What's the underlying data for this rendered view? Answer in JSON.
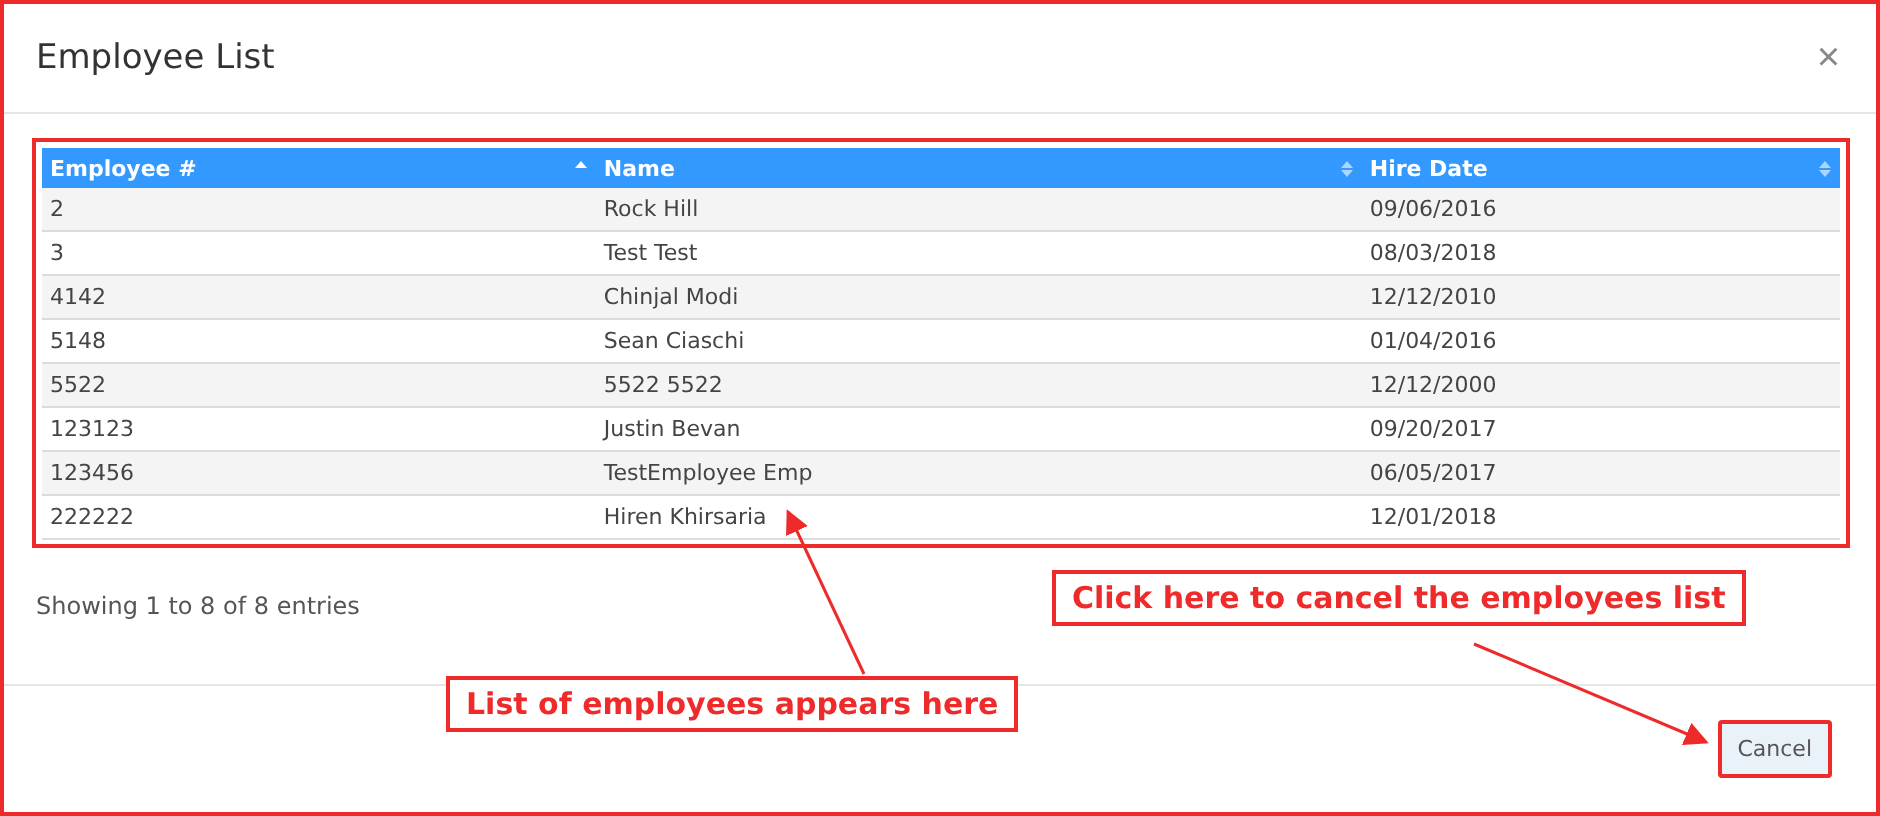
{
  "dialog": {
    "title": "Employee List",
    "close": "×"
  },
  "table": {
    "columns": [
      {
        "label": "Employee #",
        "sorted": true
      },
      {
        "label": "Name",
        "sorted": false
      },
      {
        "label": "Hire Date",
        "sorted": false
      }
    ],
    "rows": [
      [
        "2",
        "Rock Hill",
        "09/06/2016"
      ],
      [
        "3",
        "Test Test",
        "08/03/2018"
      ],
      [
        "4142",
        "Chinjal Modi",
        "12/12/2010"
      ],
      [
        "5148",
        "Sean Ciaschi",
        "01/04/2016"
      ],
      [
        "5522",
        "5522 5522",
        "12/12/2000"
      ],
      [
        "123123",
        "Justin Bevan",
        "09/20/2017"
      ],
      [
        "123456",
        "TestEmployee Emp",
        "06/05/2017"
      ],
      [
        "222222",
        "Hiren Khirsaria",
        "12/01/2018"
      ]
    ]
  },
  "info": "Showing 1 to 8 of 8 entries",
  "footer": {
    "buttons": [
      {
        "label": "Cancel"
      }
    ]
  },
  "annotations": [
    {
      "text": "Click here to cancel the employees list"
    },
    {
      "text": "List of employees appears here"
    }
  ]
}
